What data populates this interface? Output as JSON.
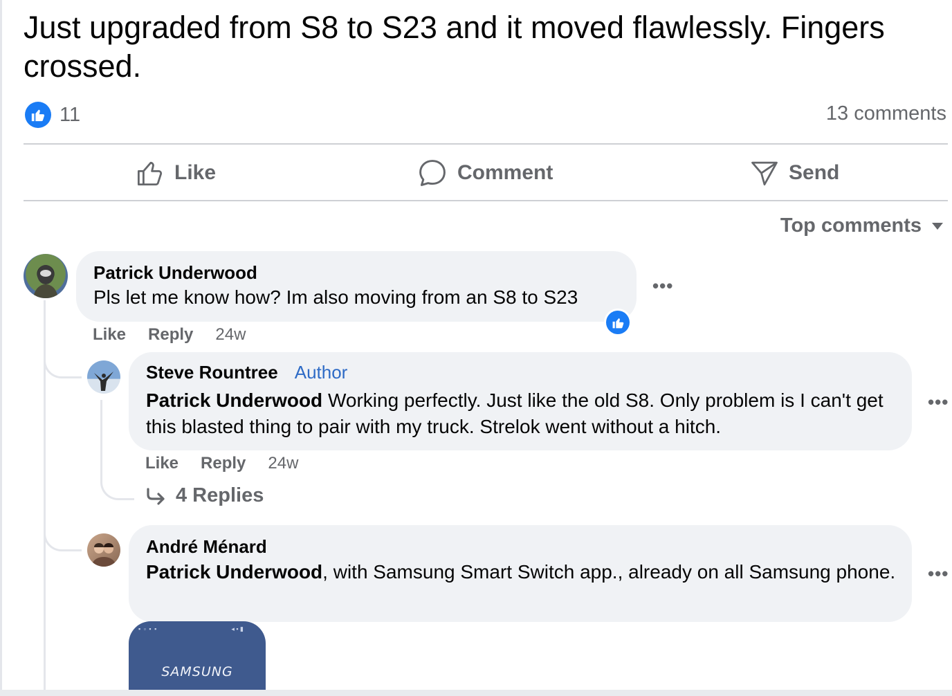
{
  "post": {
    "text": "Just upgraded from S8 to S23 and it moved flawlessly. Fingers crossed.",
    "reaction_count": "11",
    "comment_count": "13 comments"
  },
  "actions": {
    "like": "Like",
    "comment": "Comment",
    "send": "Send"
  },
  "sort_label": "Top comments",
  "comments": [
    {
      "name": "Patrick Underwood",
      "text": "Pls let me know how? Im also moving from an S8 to S23",
      "like": "Like",
      "reply": "Reply",
      "time": "24w"
    },
    {
      "name": "Steve Rountree",
      "badge": "Author",
      "mention": "Patrick Underwood",
      "text": " Working perfectly. Just like the old S8. Only problem is I can't get this blasted thing to pair with my truck. Strelok went without a hitch.",
      "like": "Like",
      "reply": "Reply",
      "time": "24w",
      "replies": "4 Replies"
    },
    {
      "name": "André Ménard",
      "mention": "Patrick Underwood",
      "text": ", with Samsung Smart Switch app., already on all Samsung phone.",
      "image_text": "SAMSUNG"
    }
  ],
  "colors": {
    "like_blue": "#1a7cf5",
    "author_blue": "#2e6bc6",
    "bubble_bg": "#f0f2f5",
    "secondary_text": "#65676b"
  },
  "icons": [
    "like-reaction-icon",
    "thumbs-up-outline-icon",
    "speech-bubble-icon",
    "send-arrow-icon",
    "caret-down-icon",
    "more-options-icon",
    "reply-arrow-icon"
  ]
}
